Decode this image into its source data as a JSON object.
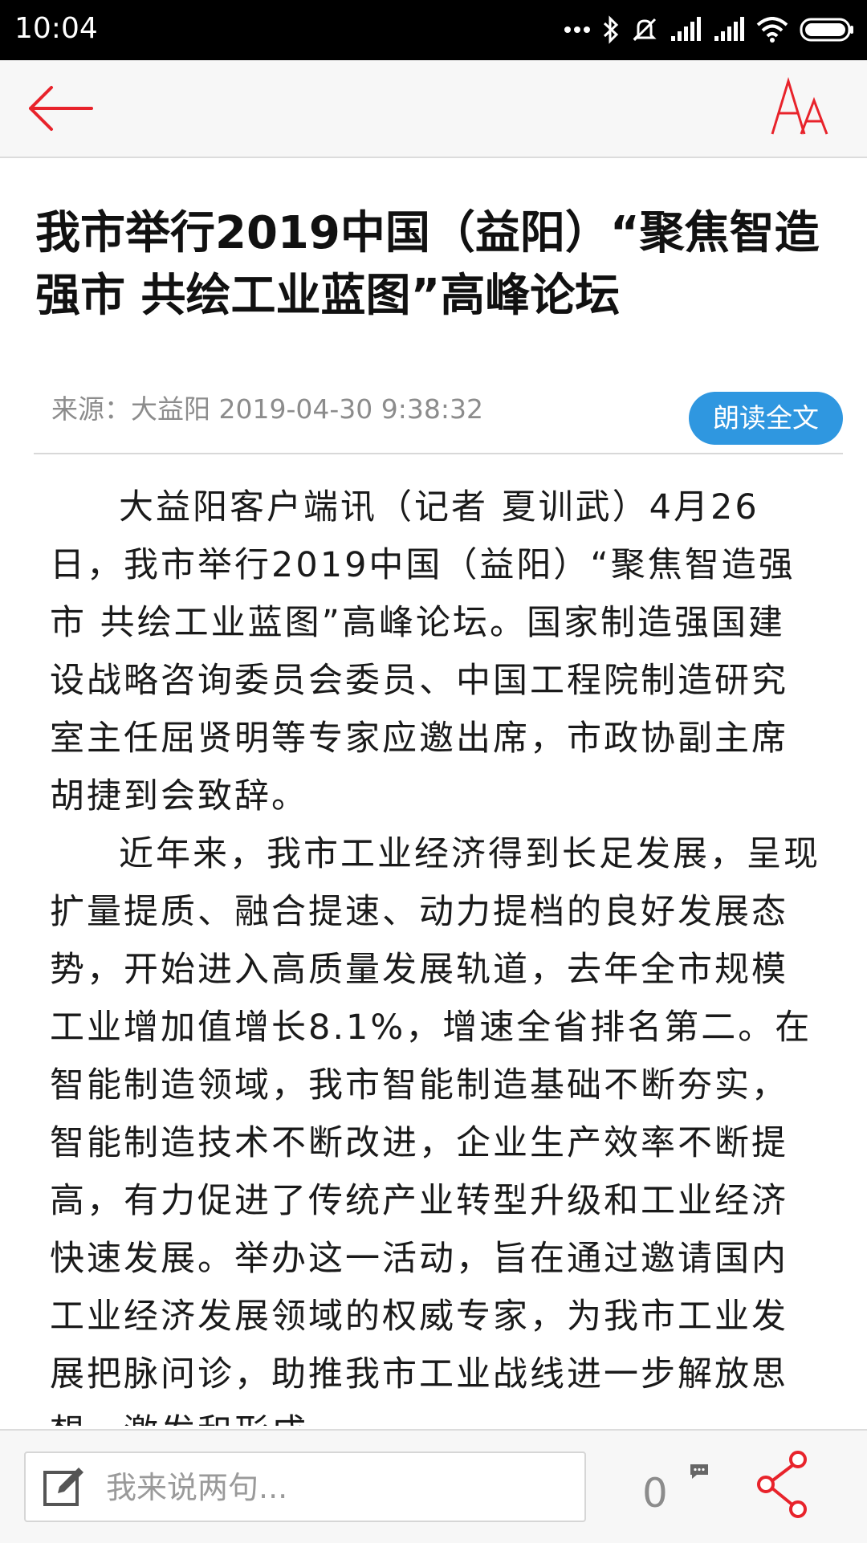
{
  "status_bar": {
    "time": "10:04"
  },
  "header": {
    "back_icon": "arrow-left-icon",
    "font_size_icon": "font-size-icon",
    "accent_color": "#e8232b"
  },
  "article": {
    "title": "我市举行2019中国（益阳）“聚焦智造强市 共绘工业蓝图”高峰论坛",
    "source": "来源：大益阳 2019-04-30 9:38:32",
    "read_aloud_label": "朗读全文",
    "paragraphs": [
      "大益阳客户端讯（记者 夏训武）4月26日，我市举行2019中国（益阳）“聚焦智造强市 共绘工业蓝图”高峰论坛。国家制造强国建设战略咨询委员会委员、中国工程院制造研究室主任屈贤明等专家应邀出席，市政协副主席胡捷到会致辞。",
      "近年来，我市工业经济得到长足发展，呈现扩量提质、融合提速、动力提档的良好发展态势，开始进入高质量发展轨道，去年全市规模工业增加值增长8.1%，增速全省排名第二。在智能制造领域，我市智能制造基础不断夯实，智能制造技术不断改进，企业生产效率不断提高，有力促进了传统产业转型升级和工业经济快速发展。举办这一活动，旨在通过邀请国内工业经济发展领域的权威专家，为我市工业发展把脉问诊，助推我市工业战线进一步解放思想，激发和形成"
    ]
  },
  "bottom_bar": {
    "comment_placeholder": "我来说两句...",
    "comment_count": "0",
    "edit_icon": "edit-icon",
    "share_icon": "share-icon"
  }
}
